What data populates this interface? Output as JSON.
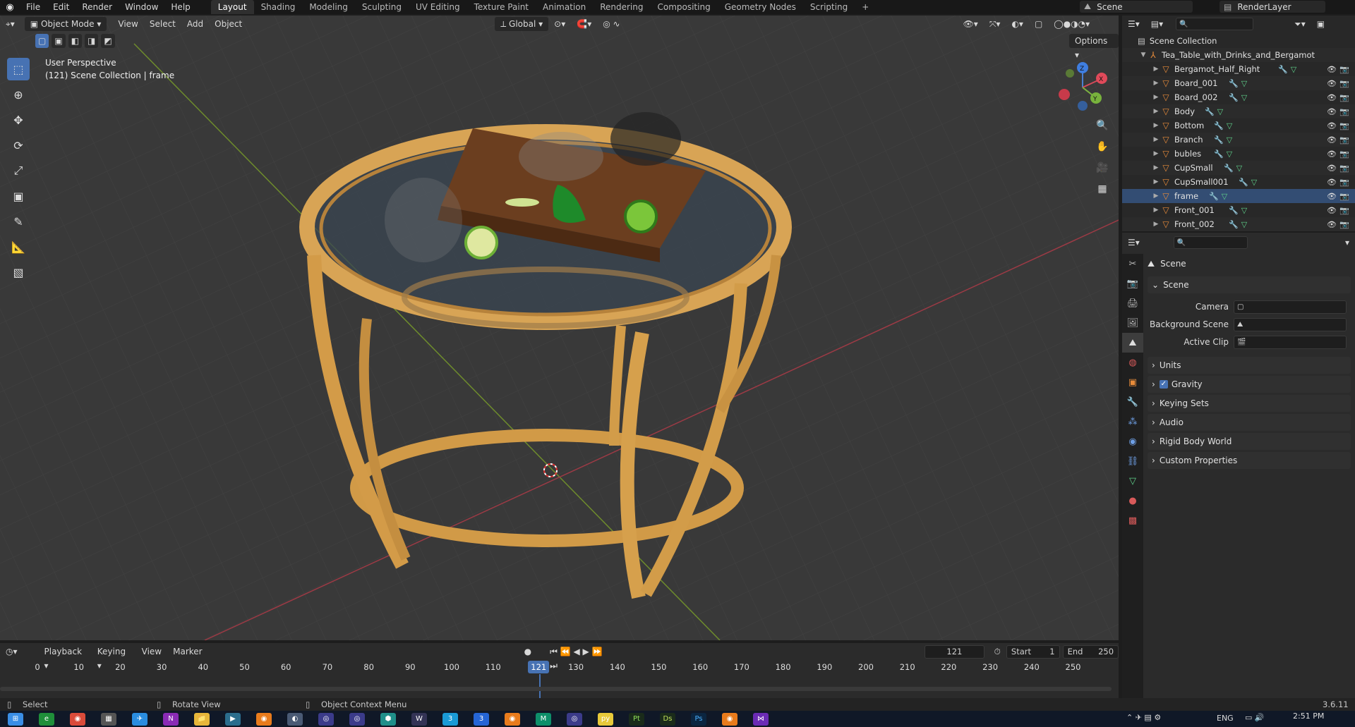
{
  "topbar": {
    "menus": [
      "File",
      "Edit",
      "Render",
      "Window",
      "Help"
    ],
    "workspaces": [
      "Layout",
      "Shading",
      "Modeling",
      "Sculpting",
      "UV Editing",
      "Texture Paint",
      "Animation",
      "Rendering",
      "Compositing",
      "Geometry Nodes",
      "Scripting"
    ],
    "add_tab": "+",
    "scene_name": "Scene",
    "view_layer": "RenderLayer"
  },
  "viewport": {
    "mode": "Object Mode",
    "menus": [
      "View",
      "Select",
      "Add",
      "Object"
    ],
    "orientation": "Global",
    "options": "Options",
    "info_line1": "User Perspective",
    "info_line2": "(121) Scene Collection | frame",
    "gizmo": {
      "x": "X",
      "y": "Y",
      "z": "Z"
    }
  },
  "outliner": {
    "root": "Scene Collection",
    "collection": "Tea_Table_with_Drinks_and_Bergamot",
    "objects": [
      "Bergamot_Half_Right",
      "Board_001",
      "Board_002",
      "Body",
      "Bottom",
      "Branch",
      "bubles",
      "CupSmall",
      "CupSmall001",
      "frame",
      "Front_001",
      "Front_002"
    ]
  },
  "properties": {
    "header": "Scene",
    "section": "Scene",
    "camera_label": "Camera",
    "background_scene_label": "Background Scene",
    "active_clip_label": "Active Clip",
    "panels": [
      "Units",
      "Gravity",
      "Keying Sets",
      "Audio",
      "Rigid Body World",
      "Custom Properties"
    ]
  },
  "timeline": {
    "menus": [
      "Playback",
      "Keying",
      "View",
      "Marker"
    ],
    "current_frame": "121",
    "start_label": "Start",
    "start_value": "1",
    "end_label": "End",
    "end_value": "250",
    "ruler": [
      "0",
      "10",
      "20",
      "30",
      "40",
      "50",
      "60",
      "70",
      "80",
      "90",
      "100",
      "110",
      "121",
      "130",
      "140",
      "150",
      "160",
      "170",
      "180",
      "190",
      "200",
      "210",
      "220",
      "230",
      "240",
      "250"
    ]
  },
  "statusbar": {
    "select": "Select",
    "rotate": "Rotate View",
    "context": "Object Context Menu",
    "version": "3.6.11"
  },
  "taskbar": {
    "lang": "ENG",
    "time": "2:51 PM"
  },
  "colors": {
    "accent": "#4772b3",
    "object_orange": "#e98c3a",
    "mesh_green": "#5fd08a"
  }
}
